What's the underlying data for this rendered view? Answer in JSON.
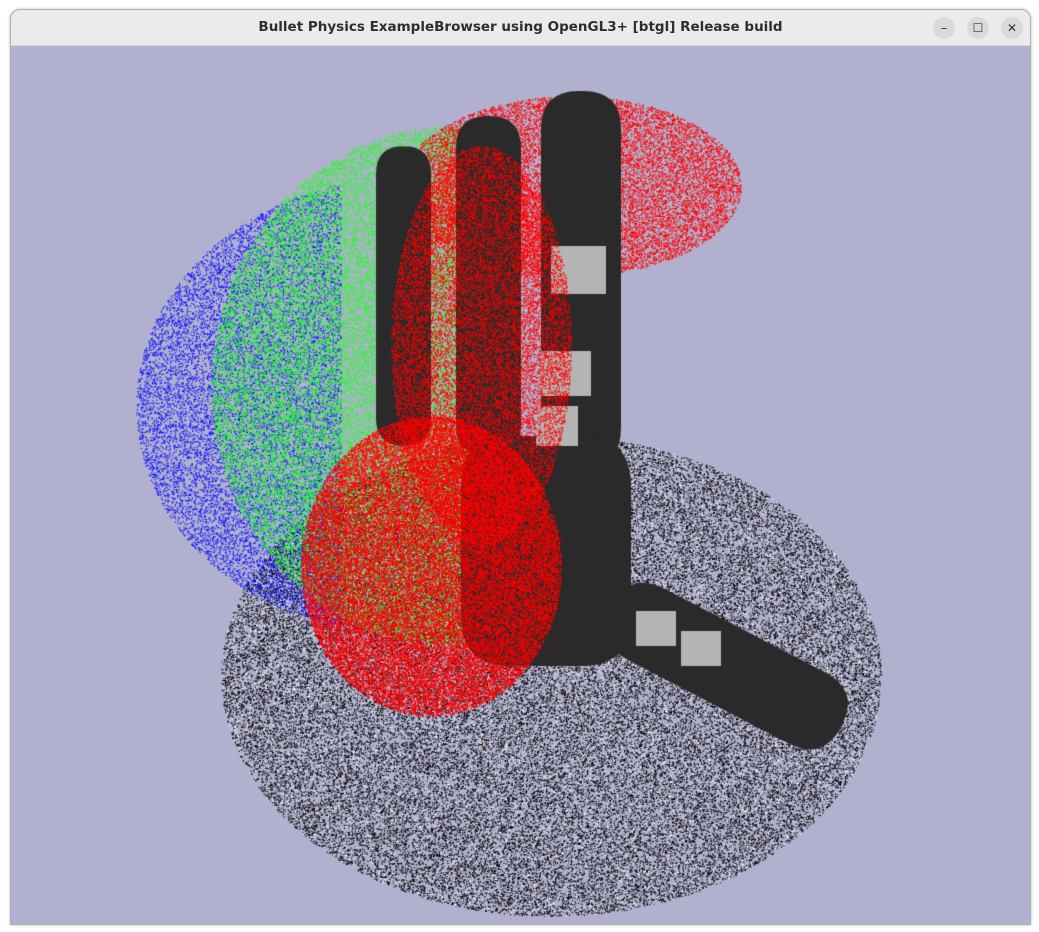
{
  "window": {
    "title": "Bullet Physics ExampleBrowser using OpenGL3+ [btgl] Release build",
    "controls": {
      "minimize_icon": "–",
      "maximize_icon": "☐",
      "close_icon": "✕"
    }
  },
  "viewport": {
    "background_color": "#b1b1cf",
    "point_colors": {
      "blue": "#1010ff",
      "green": "#20ff20",
      "red": "#ff0000",
      "black": "#000000",
      "white": "#ffffff"
    },
    "hand_colors": {
      "body": "#2a2a2a",
      "pad": "#b4b4b4"
    }
  }
}
